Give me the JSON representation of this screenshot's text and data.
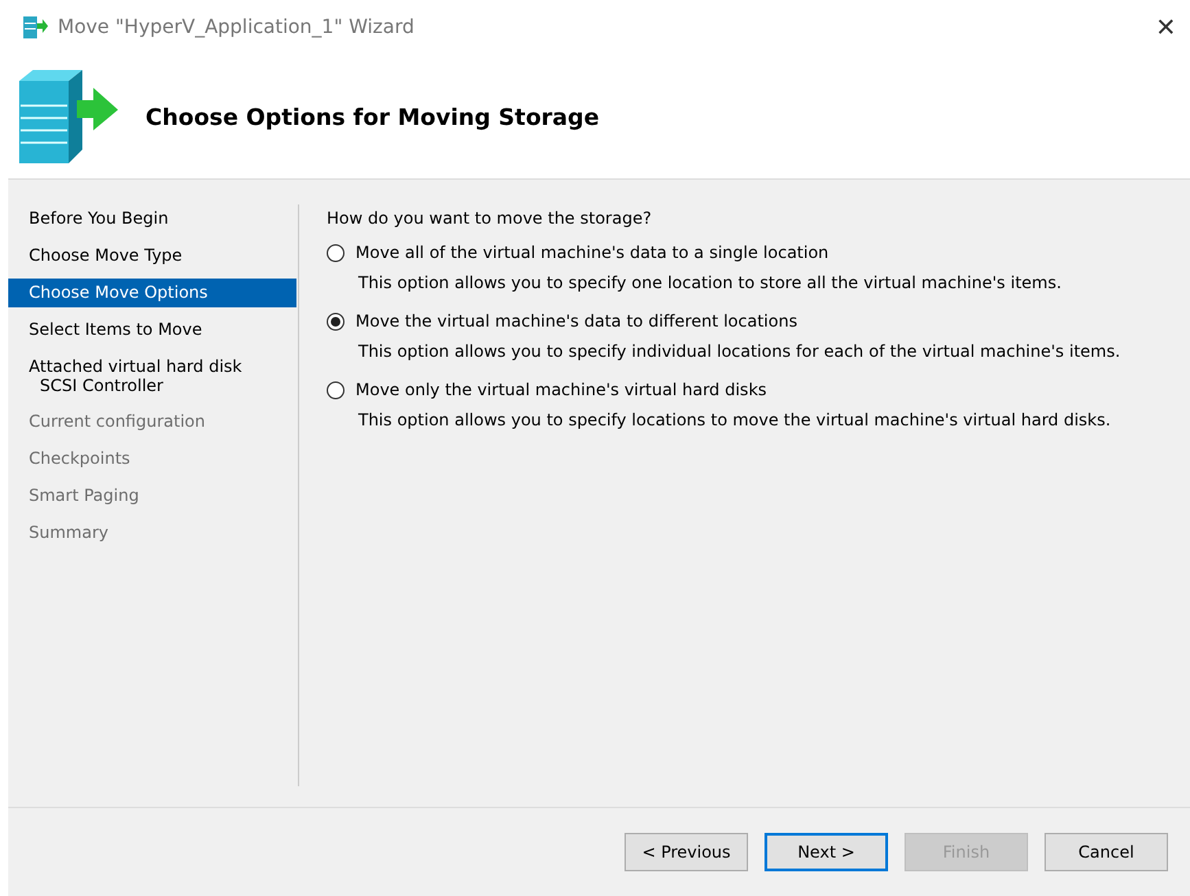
{
  "window": {
    "title": "Move \"HyperV_Application_1\" Wizard",
    "close": "✕"
  },
  "header": {
    "title": "Choose Options for Moving Storage"
  },
  "steps": [
    {
      "label": "Before You Begin",
      "selected": false,
      "disabled": false
    },
    {
      "label": "Choose Move Type",
      "selected": false,
      "disabled": false
    },
    {
      "label": "Choose Move Options",
      "selected": true,
      "disabled": false
    },
    {
      "label": "Select Items to Move",
      "selected": false,
      "disabled": false
    },
    {
      "label": "Attached virtual hard disk",
      "sublabel": "SCSI Controller",
      "selected": false,
      "disabled": false
    },
    {
      "label": "Current configuration",
      "selected": false,
      "disabled": true
    },
    {
      "label": "Checkpoints",
      "selected": false,
      "disabled": true
    },
    {
      "label": "Smart Paging",
      "selected": false,
      "disabled": true
    },
    {
      "label": "Summary",
      "selected": false,
      "disabled": true
    }
  ],
  "question": "How do you want to move the storage?",
  "options": [
    {
      "label": "Move all of the virtual machine's data to a single location",
      "description": "This option allows you to specify one location to store all the virtual machine's items.",
      "selected": false
    },
    {
      "label": "Move the virtual machine's data to different locations",
      "description": "This option allows you to specify individual locations for each of the virtual machine's items.",
      "selected": true
    },
    {
      "label": "Move only the virtual machine's virtual hard disks",
      "description": "This option allows you to specify locations to move the virtual machine's virtual hard disks.",
      "selected": false
    }
  ],
  "buttons": [
    {
      "label": "< Previous",
      "default": false,
      "disabled": false
    },
    {
      "label": "Next >",
      "default": true,
      "disabled": false
    },
    {
      "label": "Finish",
      "default": false,
      "disabled": true
    },
    {
      "label": "Cancel",
      "default": false,
      "disabled": false
    }
  ]
}
